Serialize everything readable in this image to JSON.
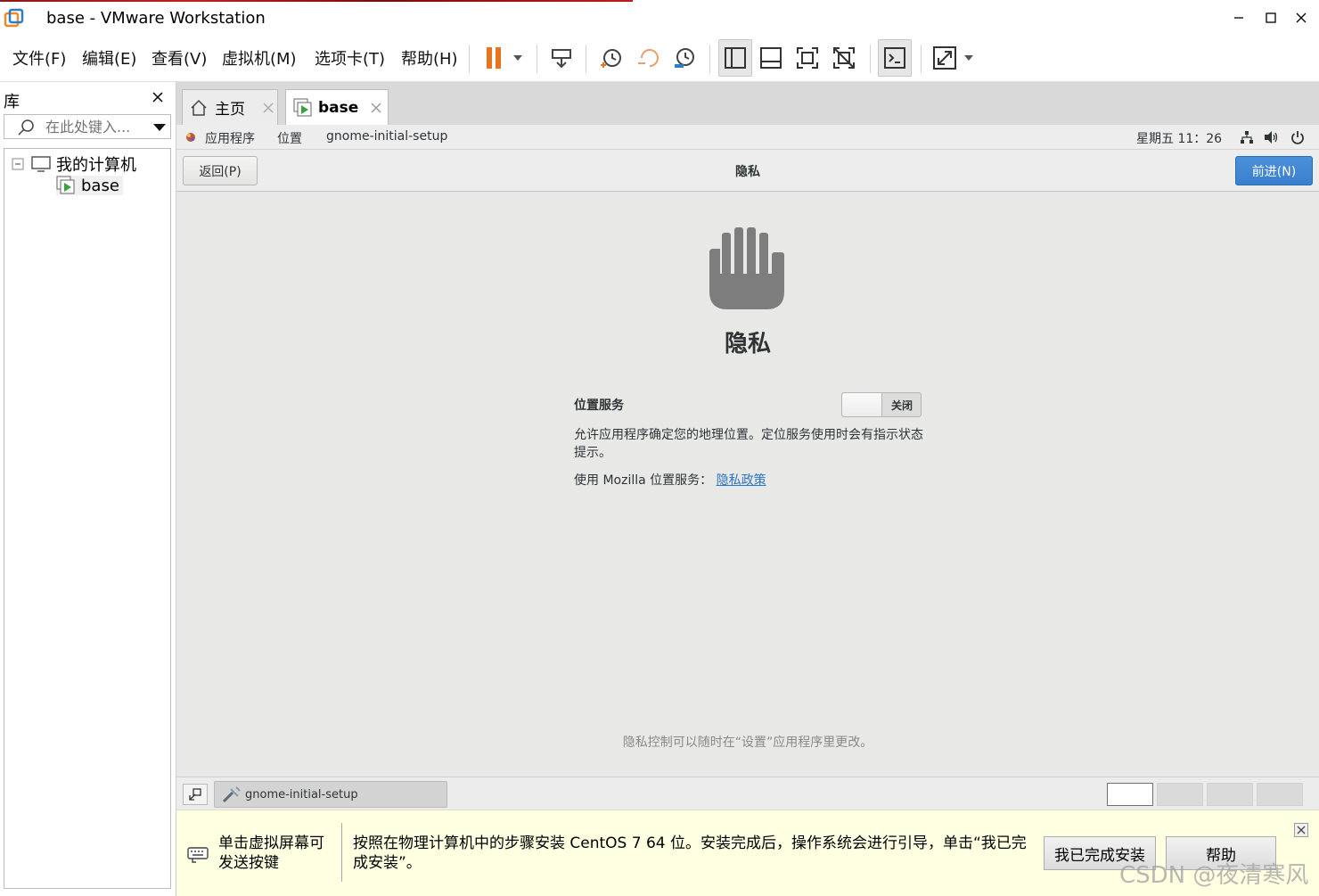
{
  "window": {
    "title": "base - VMware Workstation"
  },
  "menu": [
    "文件(F)",
    "编辑(E)",
    "查看(V)",
    "虚拟机(M)",
    "选项卡(T)",
    "帮助(H)"
  ],
  "library": {
    "title": "库",
    "search_placeholder": "在此处键入...",
    "tree": {
      "root": "我的计算机",
      "child": "base"
    }
  },
  "tabs": [
    {
      "label": "主页",
      "icon": "home-icon"
    },
    {
      "label": "base",
      "icon": "vm-icon"
    }
  ],
  "guest": {
    "top_panel": {
      "apps": "应用程序",
      "places": "位置",
      "active_app": "gnome-initial-setup",
      "clock": "星期五 11：26"
    },
    "header": {
      "back": "返回(P)",
      "title": "隐私",
      "next": "前进(N)"
    },
    "page": {
      "heading": "隐私",
      "location_label": "位置服务",
      "toggle_state": "关闭",
      "description": "允许应用程序确定您的地理位置。定位服务使用时会有指示状态提示。",
      "mozilla_prefix": "使用  Mozilla 位置服务：",
      "policy_link": "隐私政策",
      "footer": "隐私控制可以随时在“设置”应用程序里更改。"
    },
    "taskbar": {
      "task": "gnome-initial-setup"
    }
  },
  "hint": {
    "click_hint": "单击虚拟屏幕可发送按键",
    "message": "按照在物理计算机中的步骤安装 CentOS 7 64 位。安装完成后，操作系统会进行引导，单击“我已完成安装”。",
    "done_button": "我已完成安装",
    "help_button": "帮助"
  },
  "watermark": "CSDN @夜清寒风",
  "colors": {
    "accent": "#4a90d9",
    "pause": "#e8741f",
    "hint_bg": "#ffffe1"
  }
}
